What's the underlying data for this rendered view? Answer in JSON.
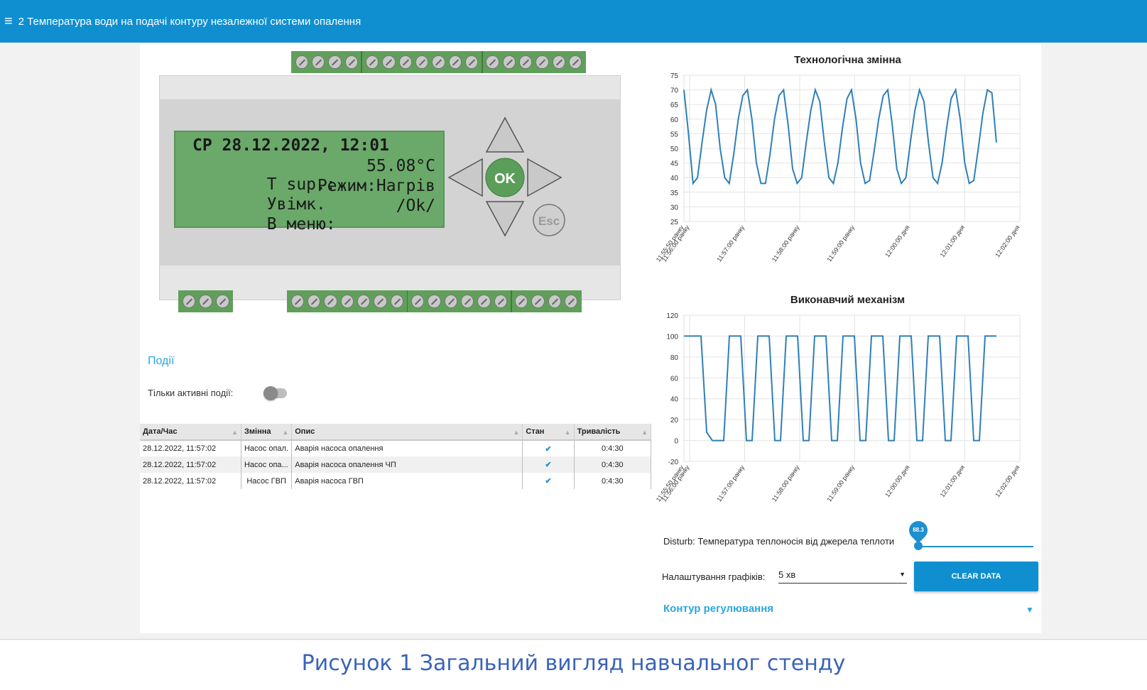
{
  "header": {
    "menu_icon": "hamburger-menu-icon",
    "title": "2 Температура води на подачі контуру незалежної системи опалення"
  },
  "controller": {
    "lcd": {
      "line1": "СР 28.12.2022, 12:01",
      "line2_left": "T sup.:",
      "line2_right": "55.08°C",
      "line3_left": "Увімк.",
      "line3_right": "Режим:Нагрів",
      "line4_left": "В меню:",
      "line4_right": "/Ok/"
    },
    "ok_label": "OK",
    "esc_label": "Esc"
  },
  "events": {
    "title": "Події",
    "toggle_label": "Тільки активні події:",
    "toggle_on": false,
    "columns": [
      "Дата/Час",
      "Змінна",
      "Опис",
      "Стан",
      "Тривалість"
    ],
    "rows": [
      {
        "datetime": "28.12.2022, 11:57:02",
        "variable": "Насос опал.",
        "description": "Аварія насоса опалення",
        "state": "✔",
        "duration": "0:4:30"
      },
      {
        "datetime": "28.12.2022, 11:57:02",
        "variable": "Насос опа...",
        "description": "Аварія насоса опалення ЧП",
        "state": "✔",
        "duration": "0:4:30"
      },
      {
        "datetime": "28.12.2022, 11:57:02",
        "variable": "Насос ГВП",
        "description": "Аварія насоса ГВП",
        "state": "✔",
        "duration": "0:4:30"
      }
    ]
  },
  "chart_data": [
    {
      "type": "line",
      "title": "Технологічна змінна",
      "ylim": [
        25,
        75
      ],
      "yticks": [
        25,
        30,
        35,
        40,
        45,
        50,
        55,
        60,
        65,
        70,
        75
      ],
      "xticks": [
        "11:55:50 ранку",
        "11:56:00 ранку",
        "11:57:00 ранку",
        "11:58:00 ранку",
        "11:59:00 ранку",
        "12:00:00 дня",
        "12:01:00 дня",
        "12:02:00 дня"
      ],
      "grid": true,
      "color": "#2f7fb8",
      "x_range": [
        "11:55:50",
        "12:02:00"
      ],
      "series": [
        {
          "values": [
            70,
            55,
            38,
            40,
            52,
            63,
            70,
            65,
            50,
            40,
            38,
            48,
            60,
            68,
            70,
            60,
            45,
            38,
            38,
            48,
            60,
            68,
            70,
            58,
            43,
            38,
            40,
            52,
            63,
            70,
            66,
            52,
            40,
            38,
            45,
            57,
            67,
            70,
            60,
            45,
            38,
            39,
            49,
            60,
            68,
            70,
            58,
            43,
            38,
            40,
            52,
            63,
            70,
            66,
            52,
            40,
            38,
            45,
            57,
            67,
            70,
            60,
            45,
            38,
            39,
            50,
            62,
            70,
            69,
            52
          ]
        }
      ]
    },
    {
      "type": "line",
      "title": "Виконавчий механізм",
      "ylim": [
        -20,
        120
      ],
      "yticks": [
        -20,
        0,
        20,
        40,
        60,
        80,
        100,
        120
      ],
      "xticks": [
        "11:55:50 ранку",
        "11:56:00 ранку",
        "11:57:00 ранку",
        "11:58:00 ранку",
        "11:59:00 ранку",
        "12:00:00 дня",
        "12:01:00 дня",
        "12:02:00 дня"
      ],
      "grid": true,
      "color": "#2f7fb8",
      "x_range": [
        "11:55:50",
        "12:02:00"
      ],
      "series": [
        {
          "values": [
            100,
            100,
            100,
            100,
            8,
            0,
            0,
            0,
            100,
            100,
            100,
            0,
            0,
            100,
            100,
            100,
            0,
            0,
            100,
            100,
            100,
            0,
            0,
            100,
            100,
            100,
            0,
            0,
            100,
            100,
            100,
            0,
            0,
            100,
            100,
            100,
            0,
            0,
            100,
            100,
            100,
            0,
            0,
            100,
            100,
            100,
            0,
            0,
            100,
            100,
            100,
            0,
            0,
            100,
            100,
            100
          ]
        }
      ]
    }
  ],
  "controls": {
    "disturb_label": "Disturb: Температура теплоносія від джерела теплоти",
    "disturb_value": "88.3",
    "disturb_fraction": 0.0,
    "graph_settings_label": "Налаштування графіків:",
    "graph_settings_value": "5 хв",
    "clear_button": "CLEAR DATA",
    "contour_title": "Контур регулювання"
  },
  "caption": "Рисунок 1 Загальний вигляд навчальног стенду"
}
